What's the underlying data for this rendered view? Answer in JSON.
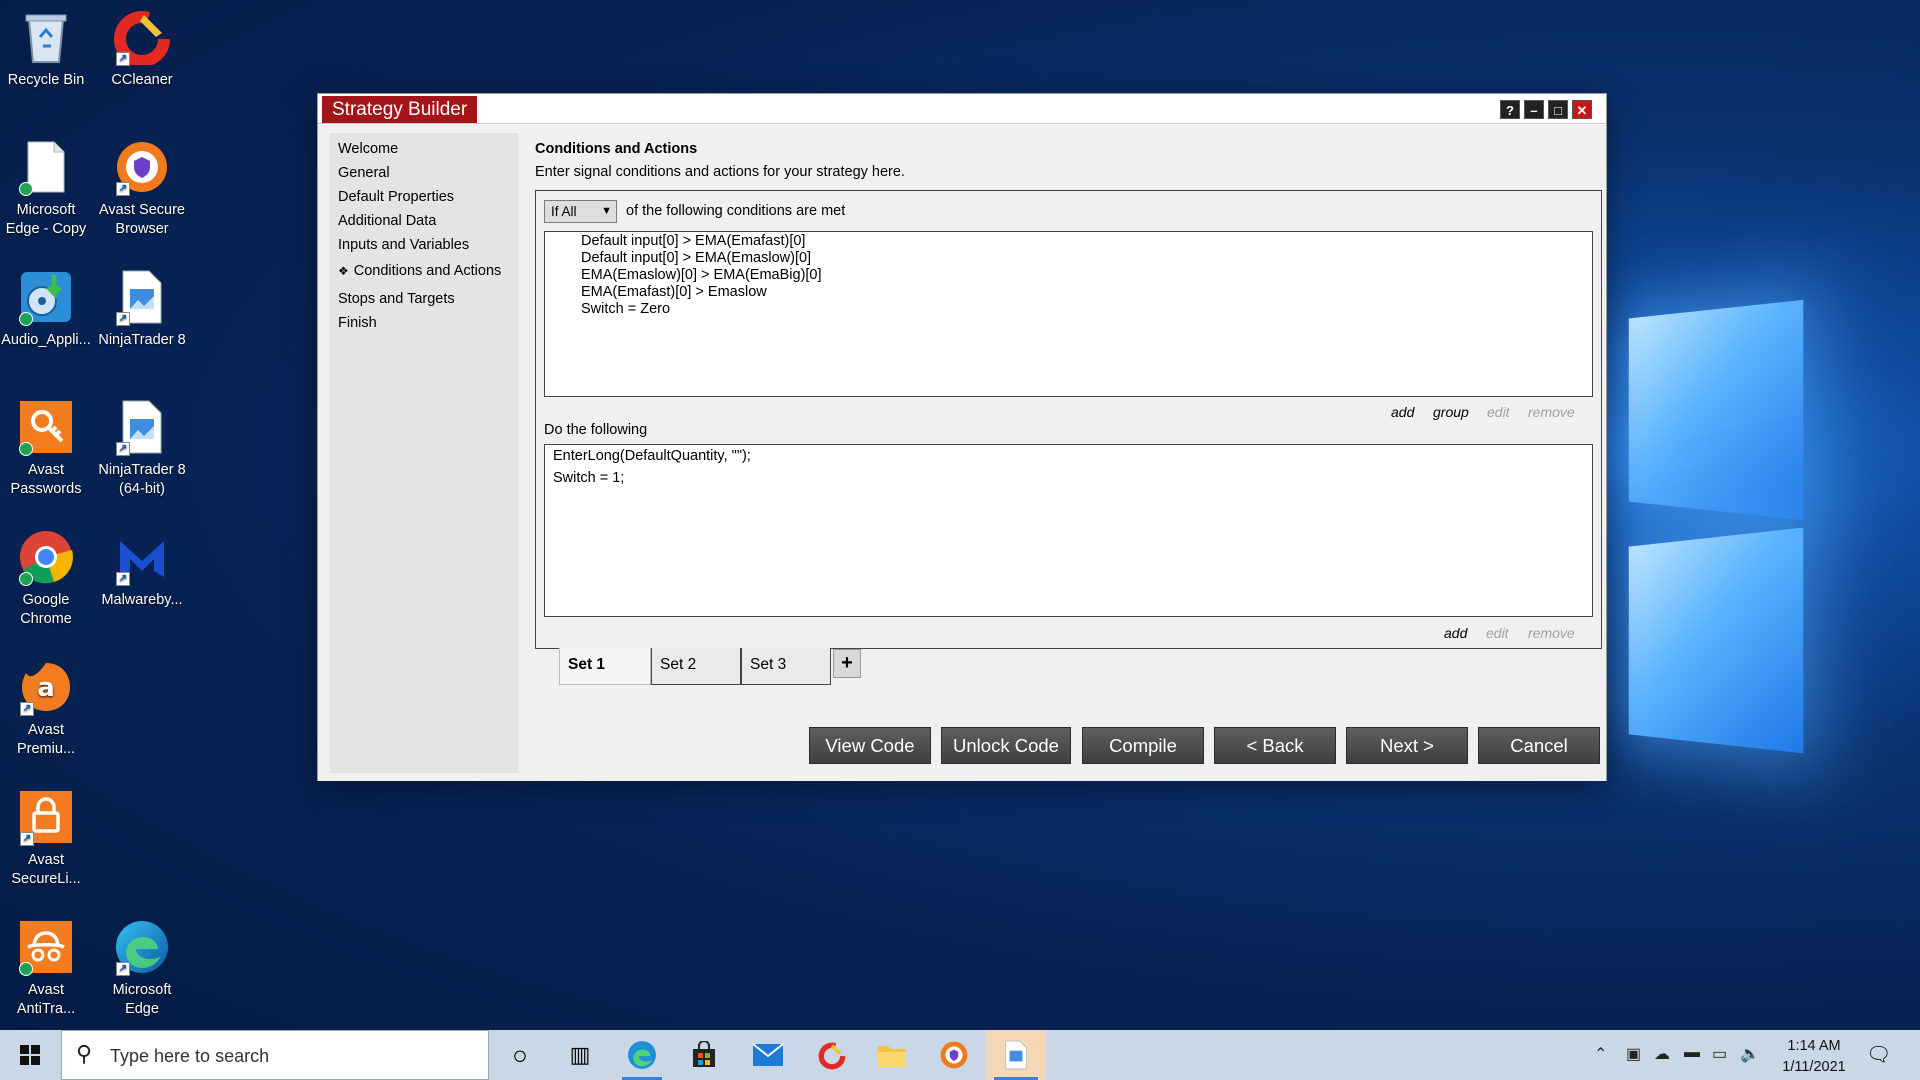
{
  "desktop": {
    "icons": [
      {
        "label": "Recycle Bin",
        "glyph": "recycle-bin-icon"
      },
      {
        "label": "CCleaner",
        "glyph": "ccleaner-icon"
      },
      {
        "label": "Microsoft Edge - Copy",
        "glyph": "file-icon"
      },
      {
        "label": "Avast Secure Browser",
        "glyph": "avast-browser-icon"
      },
      {
        "label": "Audio_Appli...",
        "glyph": "audio-installer-icon"
      },
      {
        "label": "NinjaTrader 8",
        "glyph": "ninjatrader-icon"
      },
      {
        "label": "Avast Passwords",
        "glyph": "avast-passwords-icon"
      },
      {
        "label": "NinjaTrader 8 (64-bit)",
        "glyph": "ninjatrader-icon"
      },
      {
        "label": "Google Chrome",
        "glyph": "chrome-icon"
      },
      {
        "label": "Malwareby...",
        "glyph": "malwarebytes-icon"
      },
      {
        "label": "Avast Premiu...",
        "glyph": "avast-icon"
      },
      {
        "label": "Avast SecureLi...",
        "glyph": "avast-vpn-icon"
      },
      {
        "label": "Avast AntiTra...",
        "glyph": "avast-antitrack-icon"
      },
      {
        "label": "Microsoft Edge",
        "glyph": "edge-icon"
      }
    ]
  },
  "window": {
    "title": "Strategy Builder",
    "controls": {
      "help": "?",
      "minimize": "–",
      "maximize": "□",
      "close": "✕"
    },
    "accent": "#a4141a"
  },
  "nav": {
    "items": [
      {
        "label": "Welcome"
      },
      {
        "label": "General"
      },
      {
        "label": "Default Properties"
      },
      {
        "label": "Additional Data"
      },
      {
        "label": "Inputs and Variables"
      },
      {
        "label": "Conditions and Actions",
        "current": true
      },
      {
        "label": "Stops and Targets"
      },
      {
        "label": "Finish"
      }
    ]
  },
  "content": {
    "title": "Conditions and Actions",
    "description": "Enter signal conditions and actions for your strategy here.",
    "condition_mode": "If All",
    "condition_label": "of the following conditions are met",
    "conditions": [
      "Default input[0] > EMA(Emafast)[0]",
      "Default input[0] > EMA(Emaslow)[0]",
      "EMA(Emaslow)[0] > EMA(EmaBig)[0]",
      "EMA(Emafast)[0] > Emaslow",
      "Switch = Zero"
    ],
    "condition_links": {
      "add": "add",
      "group": "group",
      "edit": "edit",
      "remove": "remove"
    },
    "do_label": "Do the following",
    "actions": [
      "EnterLong(DefaultQuantity, \"\");",
      "Switch = 1;"
    ],
    "action_links": {
      "add": "add",
      "edit": "edit",
      "remove": "remove"
    },
    "sets": [
      {
        "label": "Set 1",
        "active": true
      },
      {
        "label": "Set 2"
      },
      {
        "label": "Set 3"
      }
    ],
    "add_set_label": "+"
  },
  "buttons": {
    "view_code": "View Code",
    "unlock_code": "Unlock Code",
    "compile": "Compile",
    "back": "< Back",
    "next": "Next >",
    "cancel": "Cancel"
  },
  "taskbar": {
    "search_placeholder": "Type here to search",
    "time": "1:14 AM",
    "date": "1/11/2021"
  }
}
